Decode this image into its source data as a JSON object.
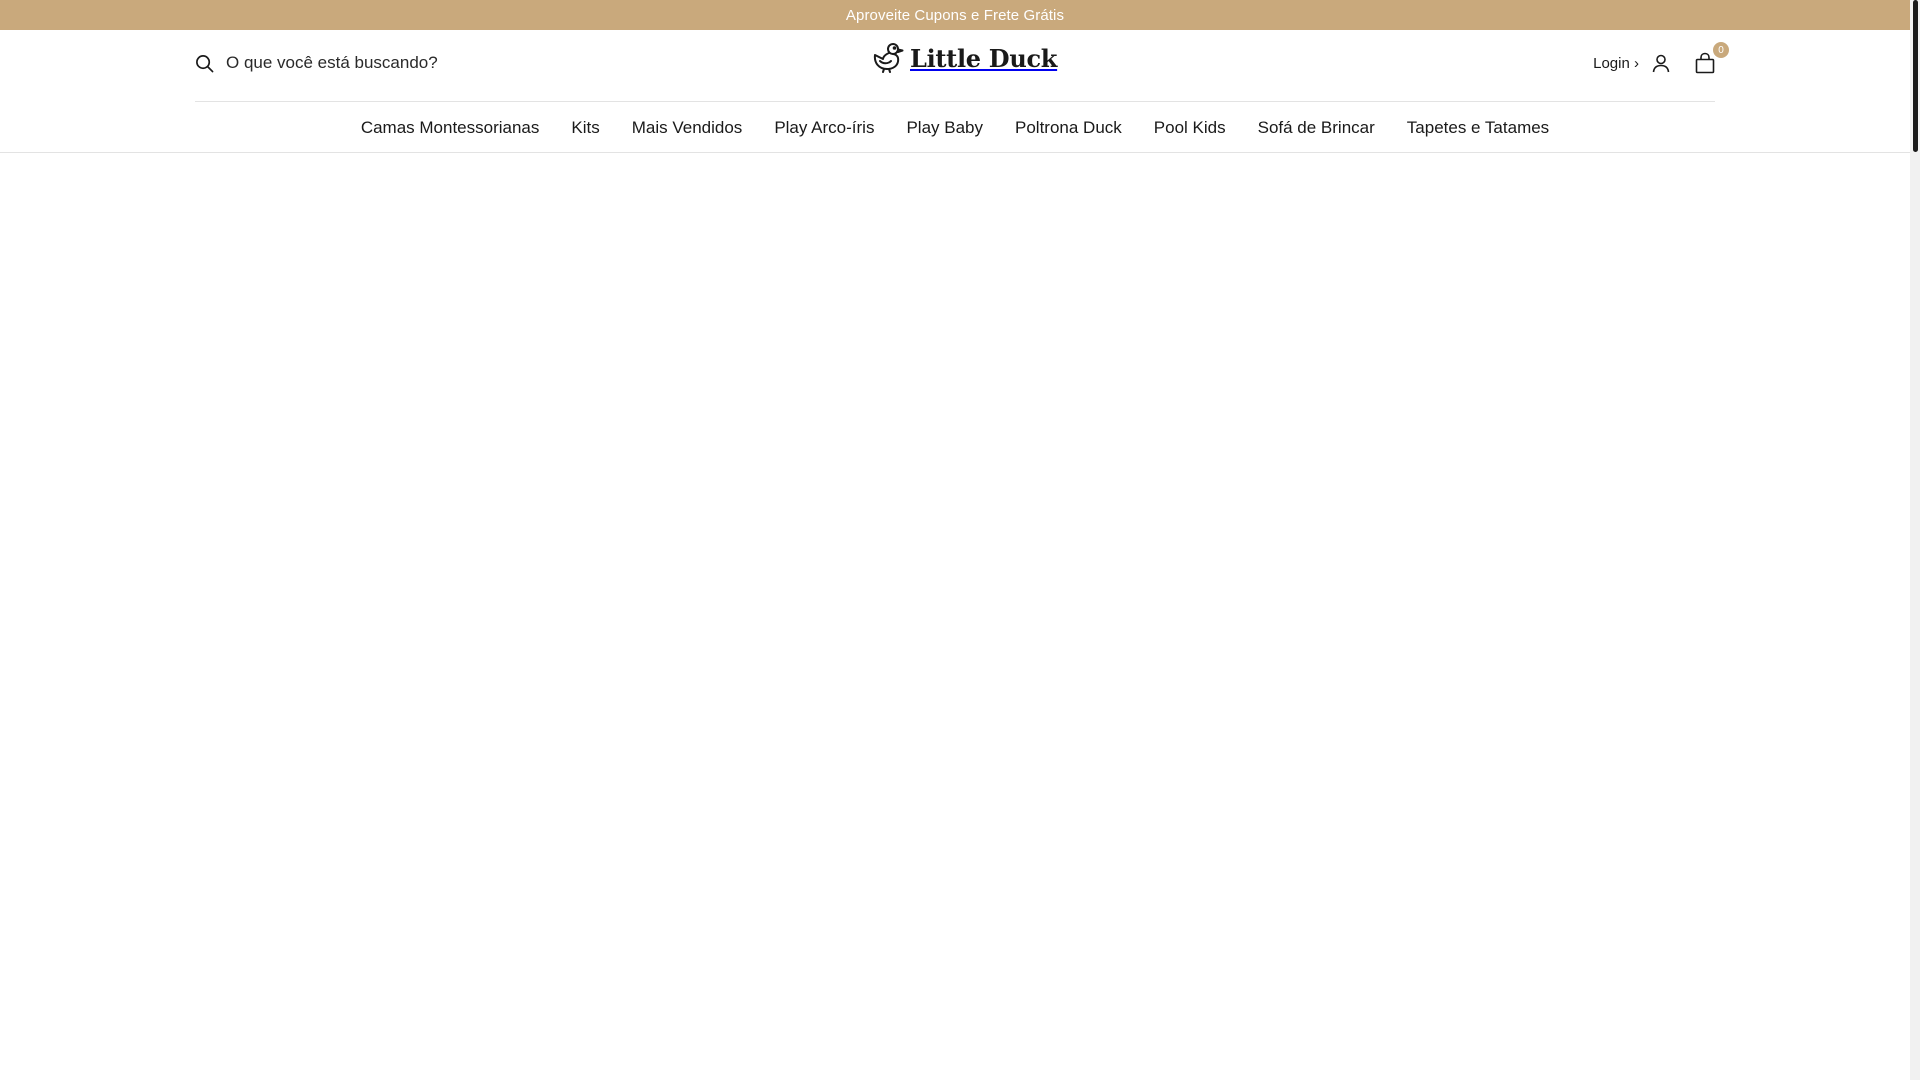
{
  "announcement": {
    "text": "Aproveite Cupons e Frete Grátis"
  },
  "header": {
    "search": {
      "placeholder": "O que você está buscando?",
      "value": ""
    },
    "logo": {
      "text": "Little Duck"
    },
    "login_label": "Login ›",
    "cart_count": "0"
  },
  "nav": {
    "items": [
      {
        "label": "Camas Montessorianas"
      },
      {
        "label": "Kits"
      },
      {
        "label": "Mais Vendidos"
      },
      {
        "label": "Play Arco-íris"
      },
      {
        "label": "Play Baby"
      },
      {
        "label": "Poltrona Duck"
      },
      {
        "label": "Pool Kids"
      },
      {
        "label": "Sofá de Brincar"
      },
      {
        "label": "Tapetes e Tatames"
      }
    ]
  },
  "colors": {
    "brand": "#c9a97c",
    "text": "#1a1a1a",
    "divider": "#e3e3e3"
  }
}
